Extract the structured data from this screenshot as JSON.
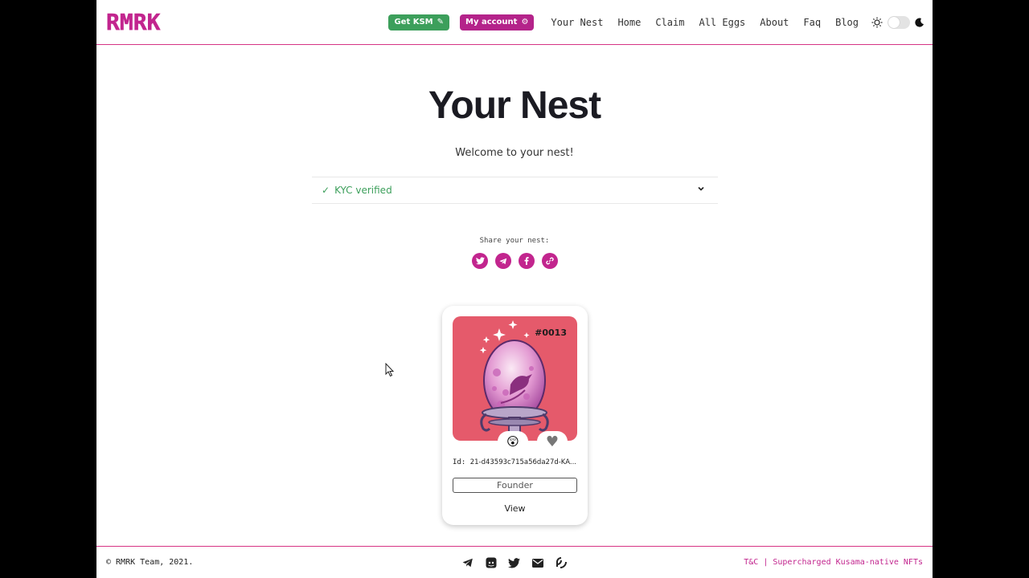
{
  "header": {
    "logo_text": "RMRK",
    "get_ksm_label": "Get KSM",
    "my_account_label": "My account",
    "nav": [
      "Your Nest",
      "Home",
      "Claim",
      "All Eggs",
      "About",
      "Faq",
      "Blog"
    ],
    "theme": {
      "light_icon": "sun-icon",
      "dark_icon": "moon-icon",
      "dark_mode": false
    }
  },
  "main": {
    "title": "Your Nest",
    "welcome": "Welcome to your nest!",
    "kyc_label": "KYC verified",
    "share_label": "Share your nest:",
    "share_icons": [
      "twitter-icon",
      "telegram-icon",
      "facebook-icon",
      "link-icon"
    ]
  },
  "card": {
    "number": "#0013",
    "reaction_emoji": "😲",
    "heart": "♥",
    "id_label": "Id:",
    "id_value": "21-d43593c715a56da27d-KA...",
    "badge": "Founder",
    "view_label": "View"
  },
  "footer": {
    "copyright": "© RMRK Team, 2021.",
    "icons": [
      "telegram-icon",
      "discord-icon",
      "twitter-icon",
      "mail-icon",
      "blog-icon"
    ],
    "tagline": "T&C | Supercharged Kusama-native NFTs"
  },
  "colors": {
    "brand": "#c2258e",
    "green": "#3c9f5b",
    "egg_bg": "#e55a6b"
  }
}
